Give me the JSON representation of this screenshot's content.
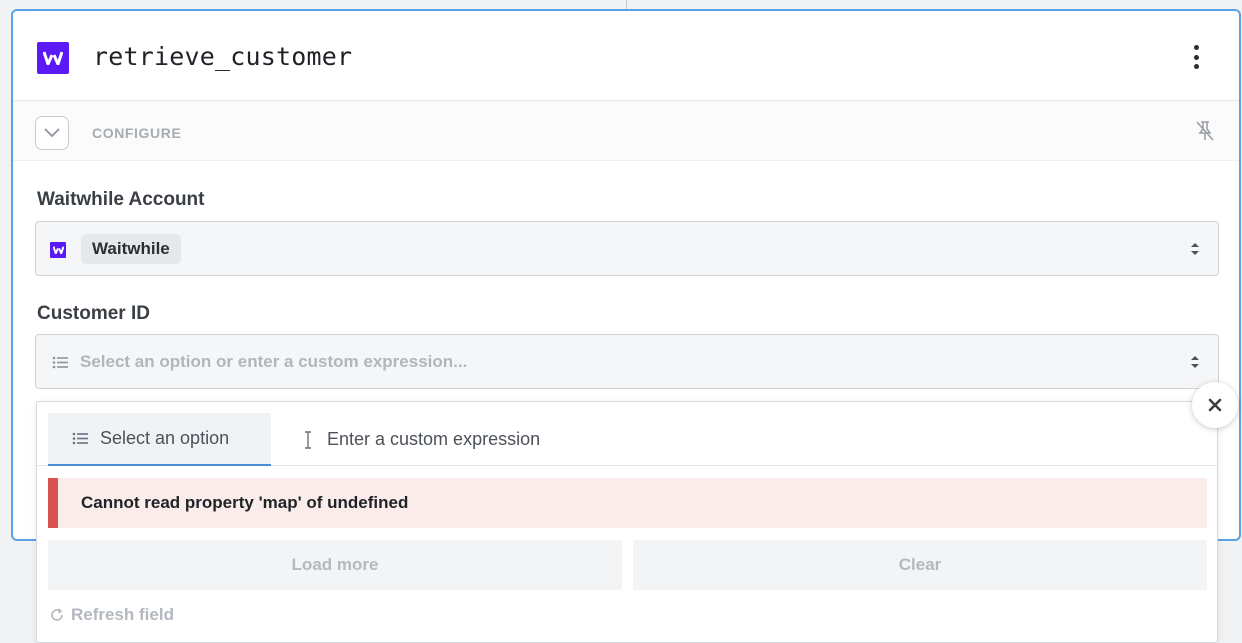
{
  "step": {
    "title": "retrieve_customer",
    "app_icon": "waitwhile-logo-icon",
    "menu_icon": "kebab-menu-icon"
  },
  "configure": {
    "label": "CONFIGURE",
    "collapse_icon": "chevron-down-icon",
    "pin_icon": "unpin-icon"
  },
  "fields": {
    "account": {
      "label": "Waitwhile Account",
      "selected": "Waitwhile"
    },
    "customer_id": {
      "label": "Customer ID",
      "placeholder": "Select an option or enter a custom expression..."
    }
  },
  "dropdown": {
    "tabs": [
      {
        "label": "Select an option",
        "icon": "list-icon",
        "active": true
      },
      {
        "label": "Enter a custom expression",
        "icon": "text-cursor-icon",
        "active": false
      }
    ],
    "error": "Cannot read property 'map' of undefined",
    "load_more_label": "Load more",
    "clear_label": "Clear",
    "refresh_label": "Refresh field"
  },
  "colors": {
    "brand": "#5b19f5",
    "card_border": "#5aa2e6",
    "error_bar": "#d9534f",
    "error_bg": "#f9eceb",
    "tab_underline": "#4a90d9"
  }
}
